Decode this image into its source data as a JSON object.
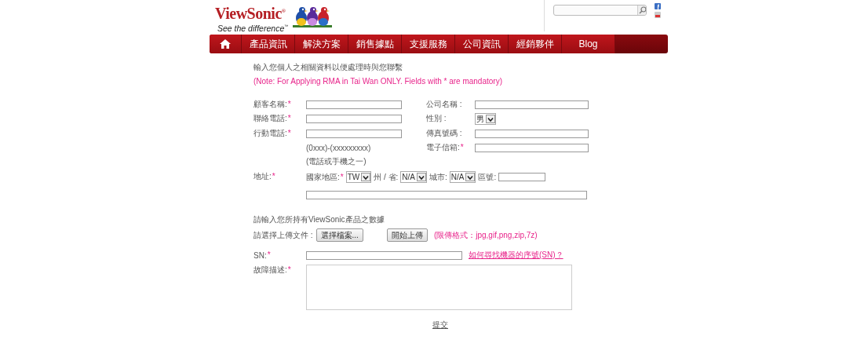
{
  "header": {
    "brand": "ViewSonic$^{®}$",
    "tagline": "See the difference$^{™}$"
  },
  "nav": [
    {
      "kind": "home"
    },
    {
      "kind": "text",
      "label": "產品資訊"
    },
    {
      "kind": "text",
      "label": "解決方案"
    },
    {
      "kind": "text",
      "label": "銷售據點"
    },
    {
      "kind": "text",
      "label": "支援服務"
    },
    {
      "kind": "text",
      "label": "公司資訊"
    },
    {
      "kind": "text",
      "label": "經銷夥伴"
    },
    {
      "kind": "text",
      "label": "Blog"
    }
  ],
  "form": {
    "intro": "輸入您個人之相關資料以便處理時與您聯繫",
    "note": "(Note: For Applying RMA in Tai Wan ONLY. Fields with * are mandatory)",
    "rows": [
      {
        "left": {
          "kind": "input",
          "label": "顧客名稱:",
          "mark": "*"
        },
        "right": {
          "kind": "input",
          "label": "公司名稱 :"
        }
      },
      {
        "left": {
          "kind": "input",
          "label": "聯絡電話:",
          "mark": "*"
        },
        "right": {
          "kind": "select",
          "label": "性別 :",
          "value": "男"
        }
      },
      {
        "left": {
          "kind": "input",
          "label": "行動電話:",
          "mark": "*"
        },
        "right": {
          "kind": "input",
          "label": "傳真號碼 :"
        }
      },
      {
        "left": {
          "kind": "hint",
          "text": "(0xxx)-(xxxxxxxxx)"
        },
        "right": {
          "kind": "input",
          "label": "電子信箱:",
          "mark": "*"
        }
      },
      {
        "left": {
          "kind": "hint",
          "text": "(電話或手機之一)"
        }
      }
    ],
    "address": {
      "label": "地址:",
      "mark": "*",
      "parts": [
        {
          "kind": "select",
          "label": "國家地區:",
          "mark": "*",
          "value": "TW"
        },
        {
          "kind": "select",
          "label": "州 / 省:",
          "value": "N/A"
        },
        {
          "kind": "select",
          "label": "城市:",
          "value": "N/A"
        },
        {
          "kind": "input",
          "label": "區號:"
        }
      ]
    },
    "product_heading": "請輸入您所持有ViewSonic產品之數據",
    "upload": {
      "label": "請選擇上傳文件 :",
      "buttons": [
        "選擇檔案...",
        "開始上傳"
      ],
      "formats": "(限傳格式：jpg,gif,png,zip,7z)"
    },
    "sn": {
      "label": "SN:",
      "mark": "*",
      "link": "如何尋找機器的序號(SN)？"
    },
    "description": {
      "label": "故障描述:",
      "mark": "*"
    },
    "submit": "提交"
  }
}
